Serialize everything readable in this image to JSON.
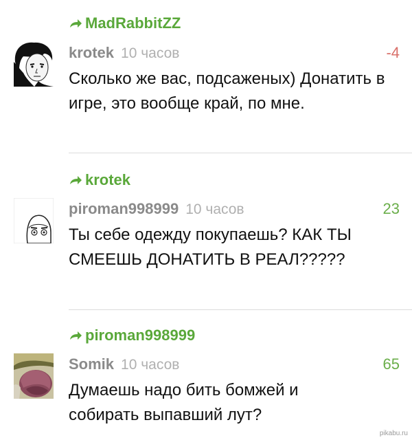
{
  "comments": [
    {
      "reply_to": "MadRabbitZZ",
      "author": "krotek",
      "time": "10 часов",
      "rating": "-4",
      "text": "Сколько же вас, подсаженых) Донатить в игре, это вообще край, по мне."
    },
    {
      "reply_to": "krotek",
      "author": "piroman998999",
      "time": "10 часов",
      "rating": "23",
      "text": "Ты себе одежду покупаешь? КАК ТЫ СМЕЕШЬ ДОНАТИТЬ В РЕАЛ?????"
    },
    {
      "reply_to": "piroman998999",
      "author": "Somik",
      "time": "10 часов",
      "rating": "65",
      "text": "Думаешь надо бить бомжей и собирать выпавший лут?"
    }
  ],
  "watermark": "pikabu.ru",
  "colors": {
    "green": "#5aa83a",
    "negative": "#d9706a",
    "positive": "#6aae4a"
  }
}
